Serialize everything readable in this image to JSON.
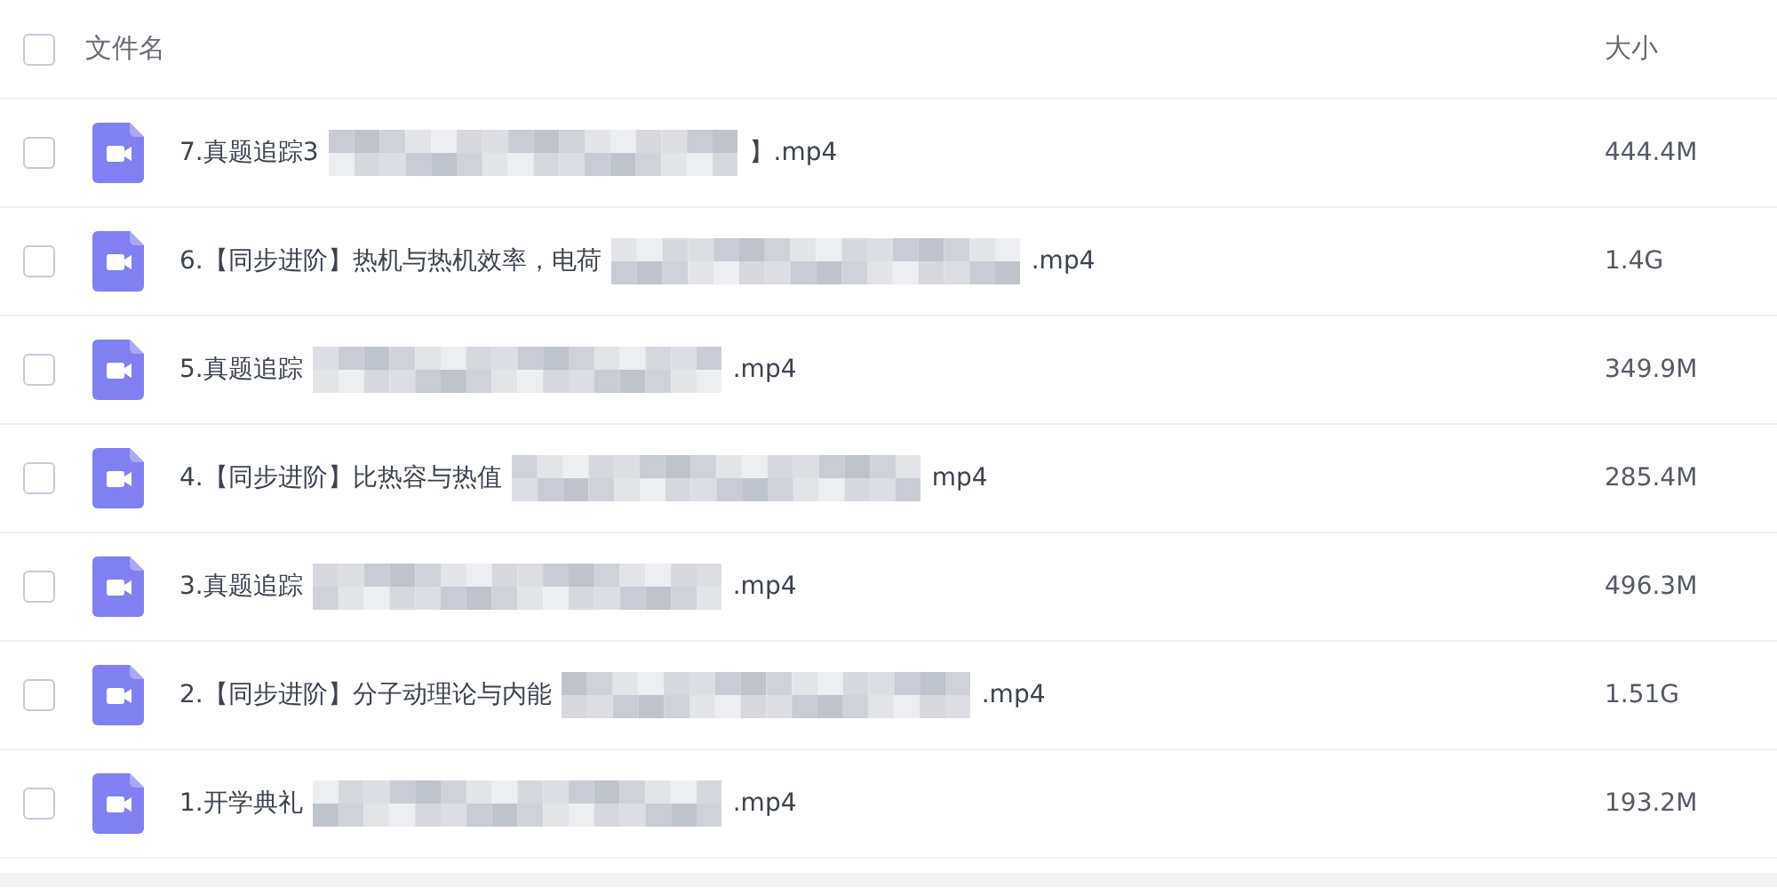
{
  "header": {
    "checked": false,
    "name_label": "文件名",
    "size_label": "大小"
  },
  "files": [
    {
      "name": "7.真题追踪3",
      "suffix": "】.mp4",
      "size": "444.4M",
      "checked": false
    },
    {
      "name": "6.【同步进阶】热机与热机效率，电荷",
      "suffix": ".mp4",
      "size": "1.4G",
      "checked": false
    },
    {
      "name": "5.真题追踪",
      "suffix": ".mp4",
      "size": "349.9M",
      "checked": false
    },
    {
      "name": "4.【同步进阶】比热容与热值",
      "suffix": "mp4",
      "size": "285.4M",
      "checked": false
    },
    {
      "name": "3.真题追踪",
      "suffix": ".mp4",
      "size": "496.3M",
      "checked": false
    },
    {
      "name": "2.【同步进阶】分子动理论与内能",
      "suffix": ".mp4",
      "size": "1.51G",
      "checked": false
    },
    {
      "name": "1.开学典礼",
      "suffix": ".mp4",
      "size": "193.2M",
      "checked": false
    }
  ]
}
